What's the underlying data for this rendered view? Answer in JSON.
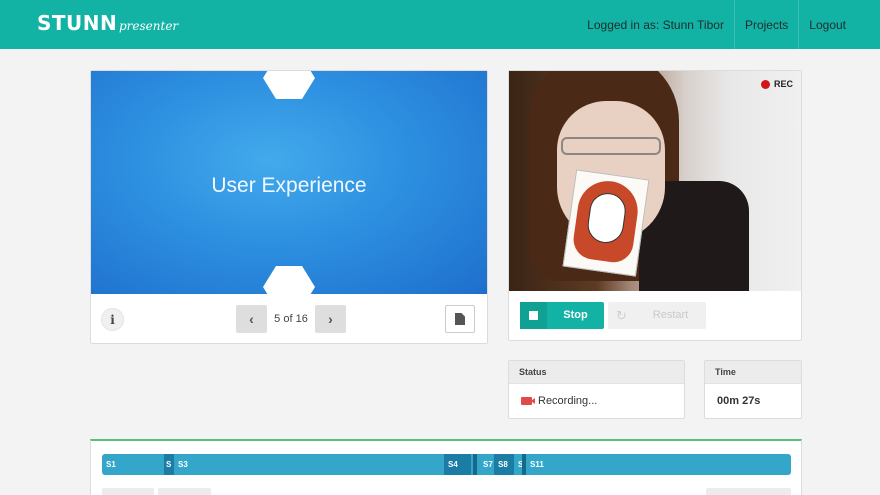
{
  "header": {
    "logo_main": "STUNN",
    "logo_sub": "presenter",
    "logged_in": "Logged in as: Stunn Tibor",
    "projects": "Projects",
    "logout": "Logout"
  },
  "slide": {
    "title": "User Experience",
    "page_indicator": "5 of 16"
  },
  "camera": {
    "rec_label": "REC",
    "stop_label": "Stop",
    "restart_label": "Restart"
  },
  "status": {
    "heading": "Status",
    "value": "Recording..."
  },
  "time": {
    "heading": "Time",
    "value": "00m 27s"
  },
  "timeline": {
    "segments": [
      "S1",
      "S",
      "S3",
      "S4",
      "S7",
      "S8",
      "S1",
      "S11"
    ]
  },
  "colors": {
    "brand": "#12b3a5",
    "rec": "#d0151d",
    "timeline_track": "#33a6c9",
    "timeline_accent": "#5cbf79"
  }
}
